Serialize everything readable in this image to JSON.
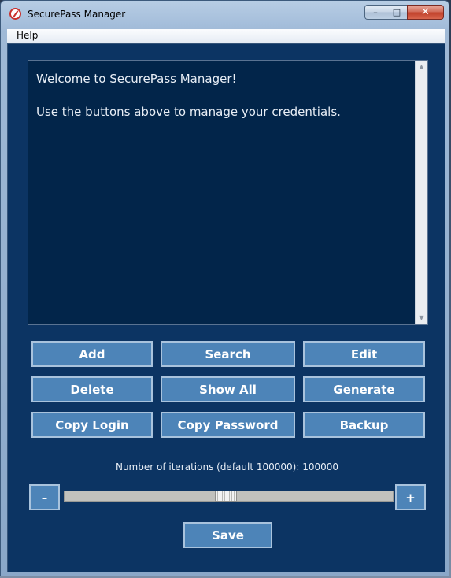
{
  "window": {
    "title": "SecurePass Manager",
    "minimize": "–",
    "maximize": "□",
    "close": "✕"
  },
  "menu": {
    "help": "Help"
  },
  "output": {
    "lines": [
      "Welcome to SecurePass Manager!",
      "Use the buttons above to manage your credentials."
    ]
  },
  "buttons": {
    "add": "Add",
    "search": "Search",
    "edit": "Edit",
    "delete": "Delete",
    "show_all": "Show All",
    "generate": "Generate",
    "copy_login": "Copy Login",
    "copy_password": "Copy Password",
    "backup": "Backup"
  },
  "iterations": {
    "label": "Number of iterations (default 100000): 100000",
    "slider_fraction": 0.49,
    "decrement": "–",
    "increment": "+"
  },
  "save": "Save",
  "colors": {
    "client_bg": "#0c3463",
    "text_area_bg": "#02254a",
    "button_bg": "#4d84b8",
    "button_border": "#a9c3dd",
    "close_button": "#c9402b"
  },
  "icons": {
    "app": "securepass-logo-icon",
    "scroll_up": "scroll-up-arrow-icon",
    "scroll_down": "scroll-down-arrow-icon"
  }
}
